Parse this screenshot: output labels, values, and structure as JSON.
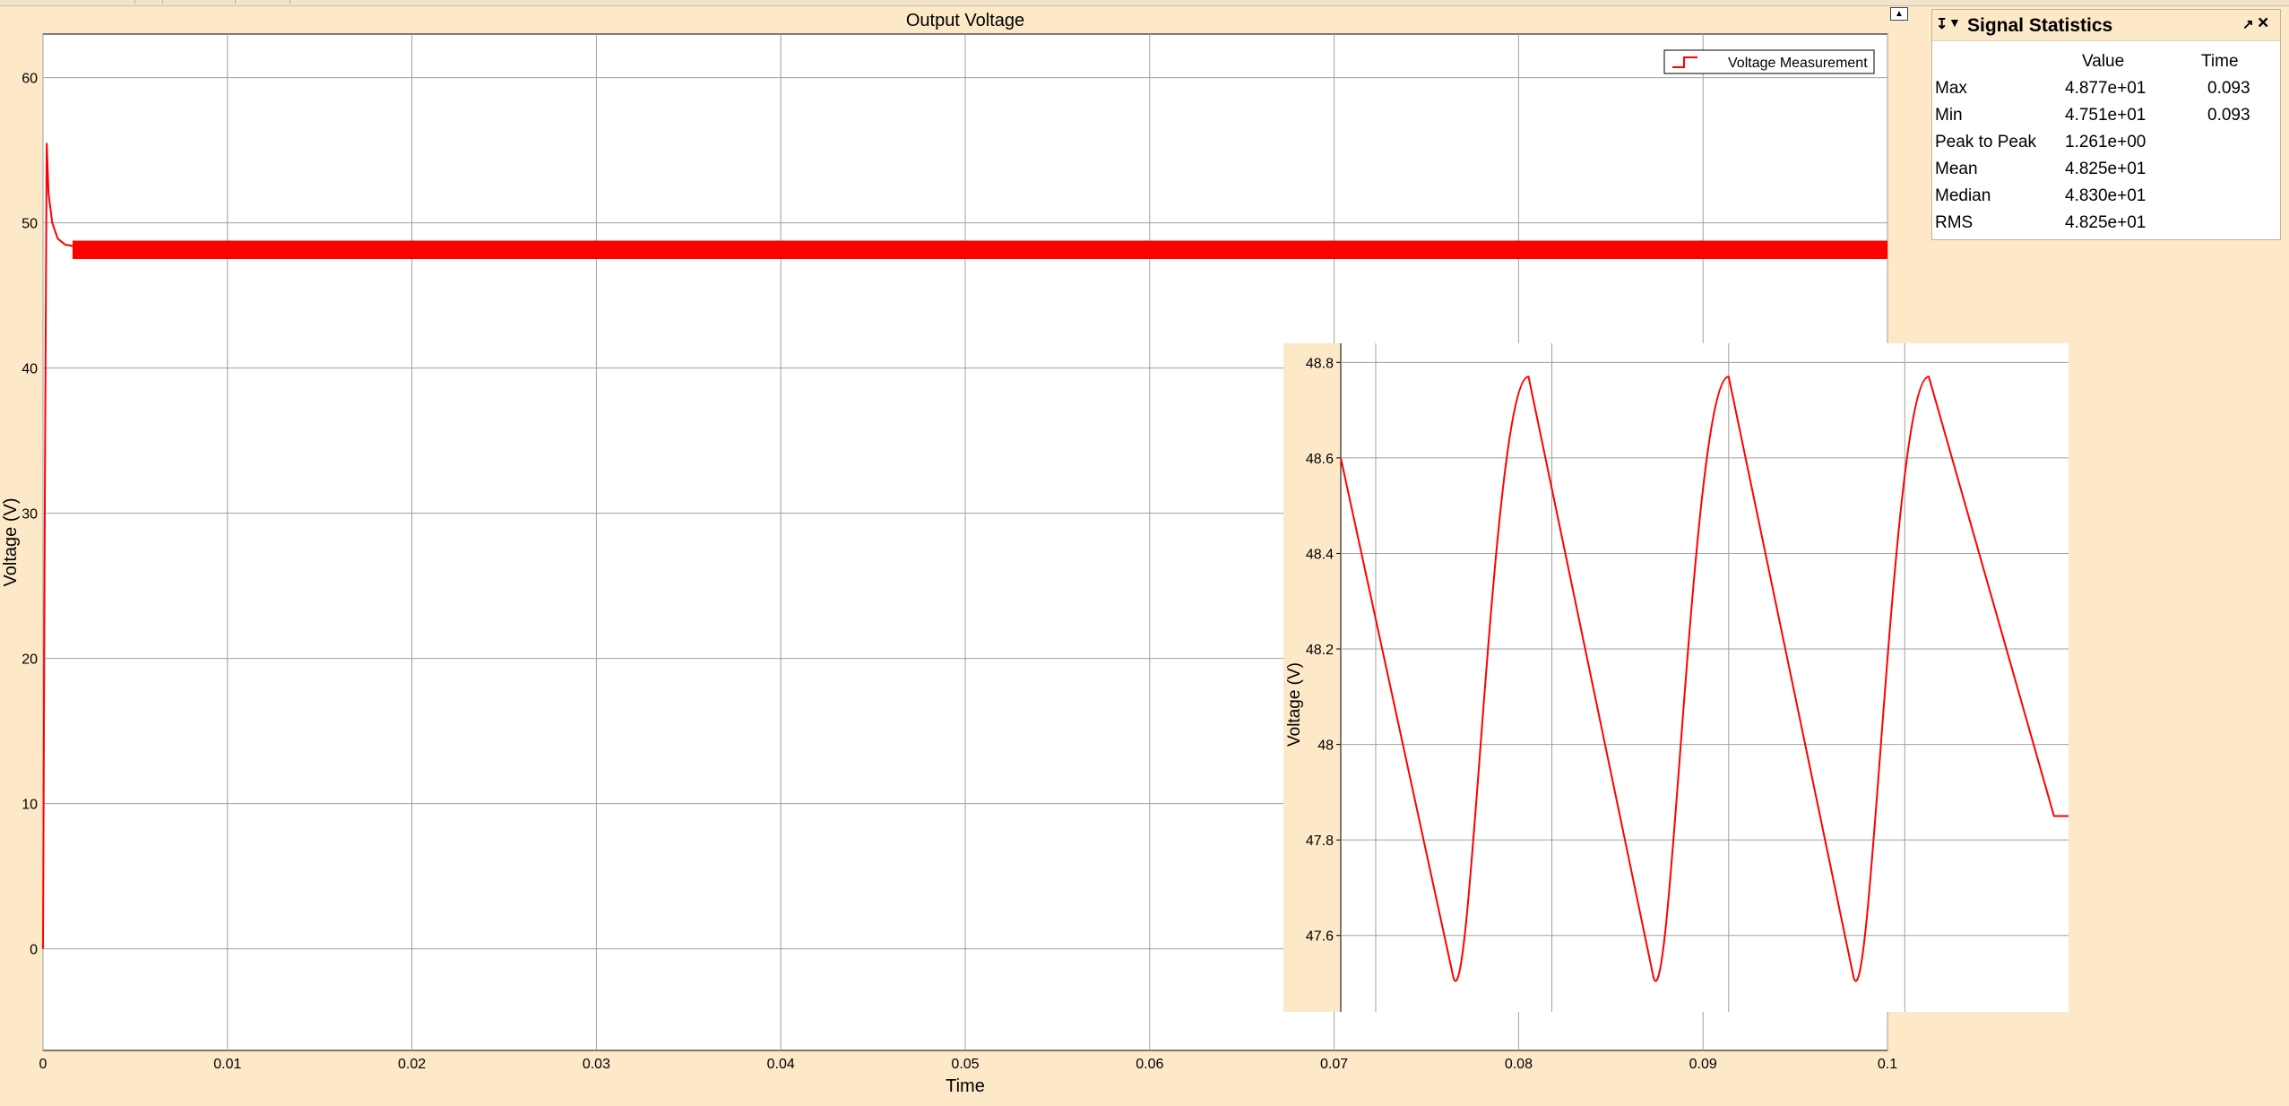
{
  "window": {
    "main_title": "Output Voltage",
    "dock_icon": "dock-figure-icon"
  },
  "chart_data": [
    {
      "type": "line",
      "title": "Output Voltage",
      "xlabel": "Time",
      "ylabel": "Voltage (V)",
      "xlim": [
        0,
        0.1
      ],
      "ylim": [
        -7,
        63
      ],
      "x_ticks": [
        "0",
        "0.01",
        "0.02",
        "0.03",
        "0.04",
        "0.05",
        "0.06",
        "0.07",
        "0.08",
        "0.09",
        "0.1"
      ],
      "y_ticks": [
        "0",
        "10",
        "20",
        "30",
        "40",
        "50",
        "60"
      ],
      "grid": true,
      "legend": {
        "position": "top-right",
        "entries": [
          "Voltage Measurement"
        ]
      },
      "series": [
        {
          "name": "Voltage Measurement",
          "color": "#ff0000",
          "description": "startup transient then steady ripple",
          "x": [
            0,
            0.0001,
            0.0002,
            0.0003,
            0.0005,
            0.0008,
            0.0012,
            0.0016,
            0.002,
            0.1
          ],
          "y": [
            0,
            32,
            55.5,
            52,
            50,
            48.9,
            48.5,
            48.4,
            48.25,
            48.25
          ],
          "ripple_min": 47.51,
          "ripple_max": 48.77
        }
      ]
    },
    {
      "type": "line",
      "title": "",
      "xlabel": "",
      "ylabel": "Voltage (V)",
      "ylim": [
        47.44,
        48.84
      ],
      "y_ticks": [
        "47.6",
        "47.8",
        "48",
        "48.2",
        "48.4",
        "48.6",
        "48.8"
      ],
      "grid": true,
      "series": [
        {
          "name": "Voltage Measurement",
          "color": "#ff0000",
          "x": [
            0,
            0.155,
            0.258,
            0.43,
            0.533,
            0.705,
            0.808,
            0.98,
            1.0
          ],
          "y": [
            48.6,
            47.51,
            48.77,
            47.51,
            48.77,
            47.51,
            48.77,
            47.85,
            47.85
          ]
        }
      ]
    }
  ],
  "stats": {
    "title": "Signal Statistics",
    "headers": {
      "value": "Value",
      "time": "Time"
    },
    "rows": [
      {
        "label": "Max",
        "value": "4.877e+01",
        "time": "0.093"
      },
      {
        "label": "Min",
        "value": "4.751e+01",
        "time": "0.093"
      },
      {
        "label": "Peak to Peak",
        "value": "1.261e+00",
        "time": ""
      },
      {
        "label": "Mean",
        "value": "4.825e+01",
        "time": ""
      },
      {
        "label": "Median",
        "value": "4.830e+01",
        "time": ""
      },
      {
        "label": "RMS",
        "value": "4.825e+01",
        "time": ""
      }
    ]
  }
}
